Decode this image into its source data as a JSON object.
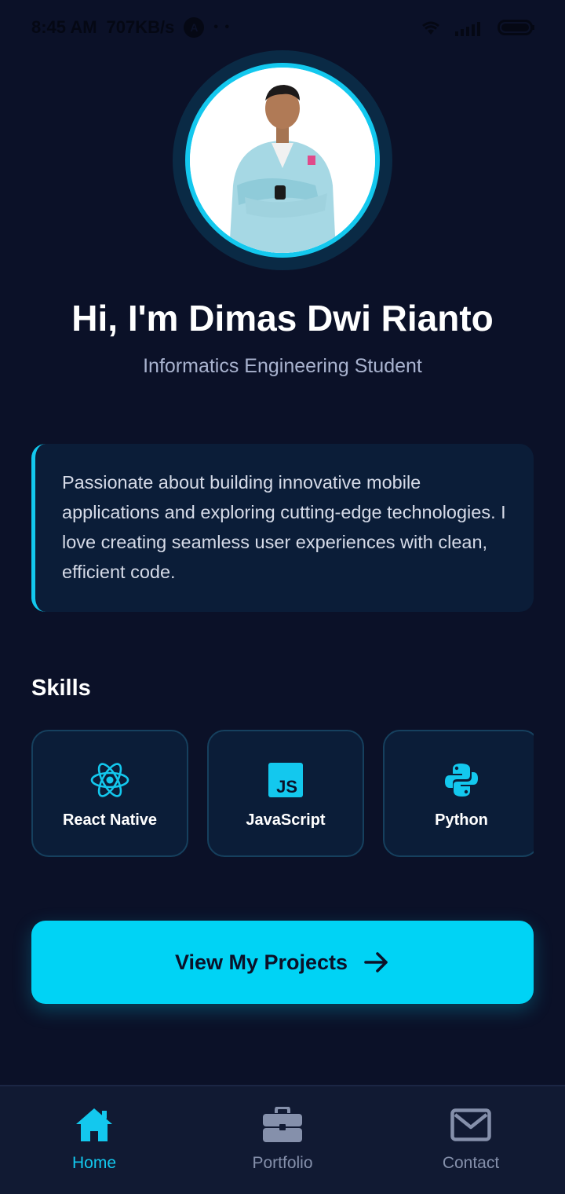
{
  "status_bar": {
    "time": "8:45 AM",
    "speed": "707KB/s",
    "badge": "A",
    "dots": "• •"
  },
  "profile": {
    "greeting": "Hi, I'm Dimas Dwi Rianto",
    "role": "Informatics Engineering Student"
  },
  "bio": {
    "text": "Passionate about building innovative mobile applications and exploring cutting-edge technologies. I love creating seamless user experiences with clean, efficient code."
  },
  "skills": {
    "title": "Skills",
    "items": [
      {
        "label": "React Native",
        "icon": "react-icon"
      },
      {
        "label": "JavaScript",
        "icon": "javascript-icon"
      },
      {
        "label": "Python",
        "icon": "python-icon"
      }
    ]
  },
  "cta": {
    "label": "View My Projects",
    "icon": "arrow-right-icon"
  },
  "nav": {
    "items": [
      {
        "label": "Home",
        "icon": "home-icon",
        "active": true
      },
      {
        "label": "Portfolio",
        "icon": "briefcase-icon",
        "active": false
      },
      {
        "label": "Contact",
        "icon": "mail-icon",
        "active": false
      }
    ]
  },
  "colors": {
    "background": "#0b1128",
    "accent": "#13c8ee",
    "cta": "#00d3f5",
    "card": "#0b1d38",
    "muted": "#8590ab"
  }
}
